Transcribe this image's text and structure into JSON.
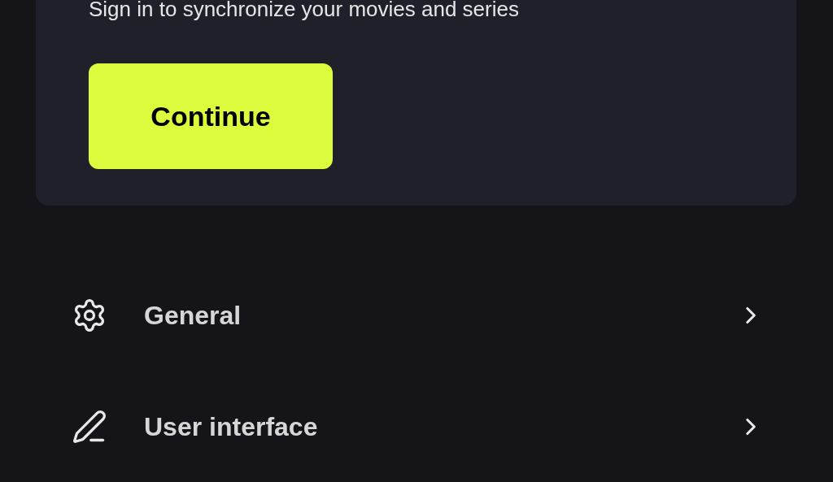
{
  "signin_card": {
    "message": "Sign in to synchronize your movies and series",
    "button": "Continue"
  },
  "settings": [
    {
      "kind": "gear",
      "label": "General"
    },
    {
      "kind": "pencil",
      "label": "User interface"
    }
  ]
}
